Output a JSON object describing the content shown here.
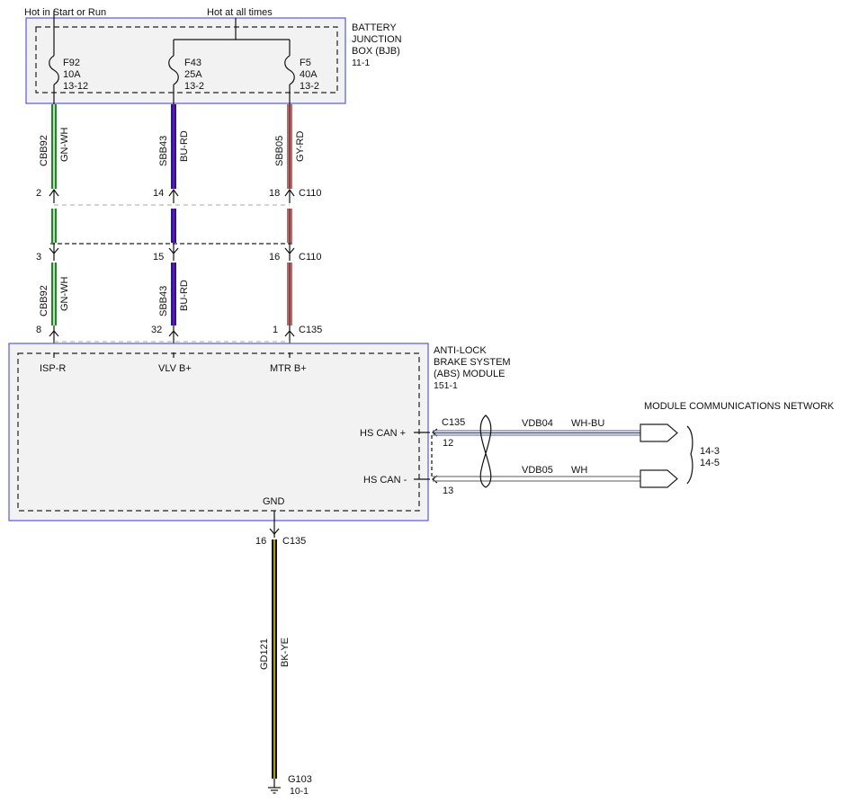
{
  "feeds": {
    "hot_in_start_or_run": "Hot in Start or Run",
    "hot_at_all_times": "Hot at all times"
  },
  "bjb": {
    "title_line1": "BATTERY",
    "title_line2": "JUNCTION",
    "title_line3": "BOX (BJB)",
    "ref": "11-1",
    "fuses": [
      {
        "name": "F92",
        "rating": "10A",
        "ref": "13-12"
      },
      {
        "name": "F43",
        "rating": "25A",
        "ref": "13-2"
      },
      {
        "name": "F5",
        "rating": "40A",
        "ref": "13-2"
      }
    ]
  },
  "circuits": [
    {
      "id": "CBB92",
      "color_code": "GN-WH",
      "wire_color": "#1f8a1f",
      "stripe_color": "#ffffff"
    },
    {
      "id": "SBB43",
      "color_code": "BU-RD",
      "wire_color": "#1515c8",
      "stripe_color": "#c82020"
    },
    {
      "id": "SBB05",
      "color_code": "GY-RD",
      "wire_color": "#b07070",
      "stripe_color": "#8a2a2a"
    }
  ],
  "c110_top": {
    "pins": [
      "2",
      "14",
      "18"
    ],
    "name": "C110"
  },
  "c110_bottom": {
    "pins": [
      "3",
      "15",
      "16"
    ],
    "name": "C110"
  },
  "c135_top": {
    "pins": [
      "8",
      "32",
      "1"
    ],
    "name": "C135"
  },
  "abs": {
    "title_line1": "ANTI-LOCK",
    "title_line2": "BRAKE SYSTEM",
    "title_line3": "(ABS) MODULE",
    "ref": "151-1",
    "pins": {
      "isp_r": "ISP-R",
      "vlv_b": "VLV B+",
      "mtr_b": "MTR B+",
      "hs_can_plus": "HS CAN +",
      "hs_can_minus": "HS CAN -",
      "gnd": "GND"
    }
  },
  "can": {
    "connector": "C135",
    "pin_plus": "12",
    "pin_minus": "13",
    "plus_circuit": "VDB04",
    "plus_color": "WH-BU",
    "minus_circuit": "VDB05",
    "minus_color": "WH",
    "network_label": "MODULE COMMUNICATIONS NETWORK",
    "ref1": "14-3",
    "ref2": "14-5"
  },
  "ground": {
    "pin": "16",
    "connector": "C135",
    "circuit": "GD121",
    "color_code": "BK-YE",
    "ground_name": "G103",
    "ground_ref": "10-1"
  }
}
